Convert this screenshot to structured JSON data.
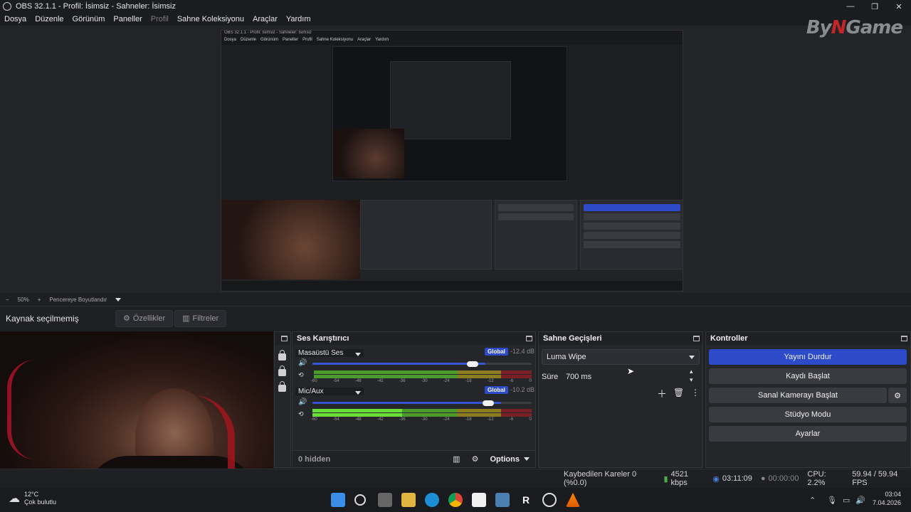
{
  "window": {
    "title": "OBS 32.1.1 - Profil: İsimsiz - Sahneler: İsimsiz",
    "controls": [
      "—",
      "❐",
      "✕"
    ]
  },
  "menu": {
    "items": [
      "Dosya",
      "Düzenle",
      "Görünüm",
      "Paneller",
      "Profil",
      "Sahne Koleksiyonu",
      "Araçlar",
      "Yardım"
    ],
    "disabled_item": "Profil"
  },
  "logo": {
    "text_a": "By",
    "text_x": "N",
    "text_b": "Game"
  },
  "zoom": {
    "minus": "−",
    "percent": "50%",
    "plus": "+",
    "fit_label": "Pencereye Boyutlandır"
  },
  "source_bar": {
    "label": "Kaynak seçilmemiş",
    "properties": "Özellikler",
    "filters": "Filtreler"
  },
  "mixer": {
    "title": "Ses Karıştırıcı",
    "channels": [
      {
        "name": "Masaüstü Ses",
        "db": "-12.4 dB",
        "global": "Global",
        "volume": 0.79,
        "meter_level": 0.0
      },
      {
        "name": "Mic/Aux",
        "db": "-10.2 dB",
        "global": "Global",
        "volume": 0.86,
        "meter_level": 0.41
      }
    ],
    "ticks": [
      "-60",
      "-54",
      "-48",
      "-42",
      "-36",
      "-30",
      "-24",
      "-18",
      "-12",
      "-6",
      "0"
    ],
    "hidden": "0 hidden",
    "options": "Options"
  },
  "transitions": {
    "title": "Sahne Geçişleri",
    "selected": "Luma Wipe",
    "duration_label": "Süre",
    "duration_value": "700 ms"
  },
  "controls": {
    "title": "Kontroller",
    "buttons": [
      "Yayını Durdur",
      "Kaydı Başlat",
      "Sanal Kamerayı Başlat",
      "Stüdyo Modu",
      "Ayarlar"
    ]
  },
  "status": {
    "dropped": "Kaybedilen Kareler 0 (%0.0)",
    "bitrate": "4521 kbps",
    "stream_time": "03:11:09",
    "rec_time": "00:00:00",
    "cpu": "CPU: 2.2%",
    "fps": "59.94 / 59.94 FPS"
  },
  "taskbar": {
    "temp": "12°C",
    "weather": "Çok bulutlu",
    "time": "03:04",
    "date": "7.04.2026"
  },
  "nested": {
    "title": "OBS 32.1.1 - Profil: İsimsiz - Sahneler: İsimsiz",
    "menu": [
      "Dosya",
      "Düzenle",
      "Görünüm",
      "Paneller",
      "Profil",
      "Sahne Koleksiyonu",
      "Araçlar",
      "Yardım"
    ]
  },
  "colors": {
    "accent": "#2d4ac9",
    "bg": "#1e1f22",
    "panel": "#25262a"
  }
}
